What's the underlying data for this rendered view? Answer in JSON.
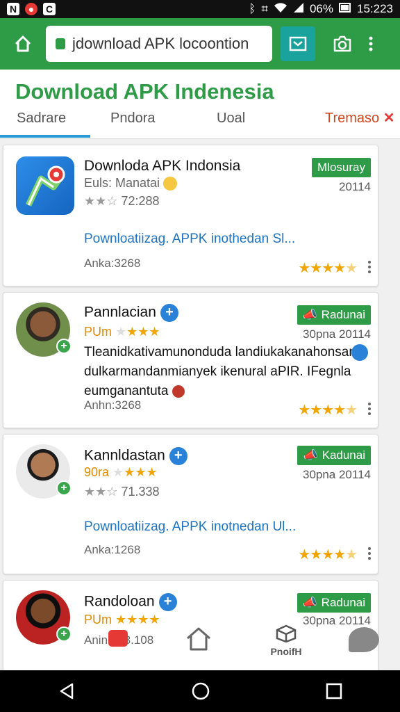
{
  "status": {
    "battery": "06%",
    "time": "15:223"
  },
  "browser": {
    "url": "jdownload APK locoontion"
  },
  "page": {
    "title": "Download APK Indenesia"
  },
  "tabs": [
    {
      "label": "Sadrare"
    },
    {
      "label": "Pndora"
    },
    {
      "label": "Uoal"
    },
    {
      "label": "Tremaso"
    }
  ],
  "cards": [
    {
      "title": "Downloda APK Indonsia",
      "subtitle": "Euls: Manatai",
      "badge": "Mlosuray",
      "date": "20114",
      "rating_count": "72:288",
      "link": "Pownloatiizag. APPK inothedan Sl...",
      "meta": "Anka:3268",
      "stars": 4.5
    },
    {
      "title": "Pannlacian",
      "subtitle": "PUm",
      "badge": "Radunai",
      "date": "30pna 20114",
      "desc": "Tleanidkativamunonduda landiukakanahonsan. dulkarmandanmianyek ikenural aPIR. IFegnla eumganantuta",
      "meta": "Anhn:3268",
      "stars": 4.5
    },
    {
      "title": "Kannldastan",
      "subtitle": "90ra",
      "badge": "Kadunai",
      "date": "30pna 20114",
      "rating_count": "71.338",
      "link": "Pownloatiizag. APPK inotnedan Ul...",
      "meta": "Anka:1268",
      "stars": 4.5
    },
    {
      "title": "Randoloan",
      "subtitle": "PUm",
      "badge": "Radunai",
      "date": "30pna 20114",
      "meta": "Anino 18.108"
    }
  ],
  "bottom_nav": {
    "profile_label": "PnoifH"
  }
}
